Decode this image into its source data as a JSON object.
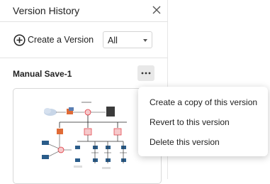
{
  "panel": {
    "title": "Version History",
    "create_label": "Create a Version",
    "filter_value": "All"
  },
  "version": {
    "name": "Manual Save-1"
  },
  "context_menu": {
    "items": [
      {
        "label": "Create a copy of this version"
      },
      {
        "label": "Revert to this version"
      },
      {
        "label": "Delete this version"
      }
    ]
  },
  "colors": {
    "text": "#222222",
    "divider": "#e3e3e3",
    "more_button_bg": "#e8e8e8",
    "router": "#e0343b",
    "firewall": "#e05a2c",
    "device": "#2a5c8a"
  },
  "icons": {
    "close": "close-icon",
    "create": "plus-circle-icon",
    "filter": "chevron-down-icon",
    "more": "more-horizontal-icon"
  }
}
